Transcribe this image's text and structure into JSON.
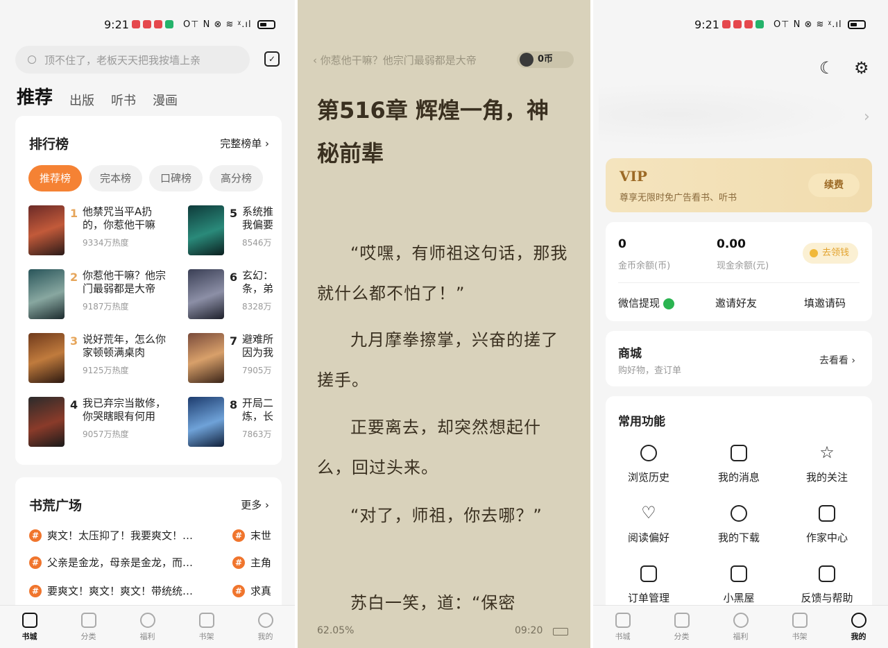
{
  "status": {
    "time": "9:21",
    "sys": "O⊤ N ⊗ ≋ ᵡ.ıl"
  },
  "home": {
    "search_placeholder": "顶不住了，老板天天把我按墙上亲",
    "tabs": [
      "推荐",
      "出版",
      "听书",
      "漫画"
    ],
    "ranking": {
      "title": "排行榜",
      "more": "完整榜单 ›",
      "chips": [
        "推荐榜",
        "完本榜",
        "口碑榜",
        "高分榜"
      ],
      "books": [
        {
          "rank": "1",
          "title": "他禁咒当平A扔的，你惹他干嘛",
          "heat": "9334万热度"
        },
        {
          "rank": "2",
          "title": "你惹他干嘛？他宗门最弱都是大帝",
          "heat": "9187万热度"
        },
        {
          "rank": "3",
          "title": "说好荒年，怎么你家顿顿满桌肉",
          "heat": "9125万热度"
        },
        {
          "rank": "4",
          "title": "我已弃宗当散修，你哭瞎眼有何用",
          "heat": "9057万热度"
        },
        {
          "rank": "5",
          "title": "系统推我偏要",
          "heat": "8546万"
        },
        {
          "rank": "6",
          "title": "玄幻：条，弟",
          "heat": "8328万"
        },
        {
          "rank": "7",
          "title": "避难所因为我",
          "heat": "7905万"
        },
        {
          "rank": "8",
          "title": "开局二炼，长",
          "heat": "7863万"
        }
      ]
    },
    "plaza": {
      "title": "书荒广场",
      "more": "更多 ›",
      "left": [
        "爽文！太压抑了！我要爽文！…",
        "父亲是金龙，母亲是金龙，而…",
        "要爽文！爽文！爽文！带统统…"
      ],
      "right": [
        "末世",
        "主角",
        "求真"
      ]
    }
  },
  "nav": [
    "书城",
    "分类",
    "福利",
    "书架",
    "我的"
  ],
  "reader": {
    "breadcrumb": "‹  你惹他干嘛？他宗门最弱都是大帝",
    "coins": "0币",
    "chapter": "第516章 辉煌一角，神秘前辈",
    "paragraphs": [
      "“哎嘿，有师祖这句话，那我就什么都不怕了！”",
      "九月摩拳擦掌，兴奋的搓了搓手。",
      "正要离去，却突然想起什么，回过头来。",
      "“对了，师祖，你去哪？”",
      "苏白一笑，道：“保密"
    ],
    "progress": "62.05%",
    "clock": "09:20"
  },
  "profile": {
    "vip": {
      "title": "VIP",
      "subtitle": "尊享无限时免广告看书、听书",
      "button": "续费"
    },
    "wallet": {
      "coin_value": "0",
      "coin_label": "金币余额(币)",
      "cash_value": "0.00",
      "cash_label": "现金余额(元)",
      "earn_button": "去领钱",
      "actions": [
        "微信提现",
        "邀请好友",
        "填邀请码"
      ]
    },
    "shop": {
      "title": "商城",
      "subtitle": "购好物，查订单",
      "more": "去看看 ›"
    },
    "functions": {
      "title": "常用功能",
      "items": [
        "浏览历史",
        "我的消息",
        "我的关注",
        "阅读偏好",
        "我的下载",
        "作家中心",
        "订单管理",
        "小黑屋",
        "反馈与帮助"
      ]
    }
  },
  "colors": {
    "accent": "#f58234",
    "reader_bg": "#d9d2bb",
    "vip_gold": "#9c6a26"
  }
}
